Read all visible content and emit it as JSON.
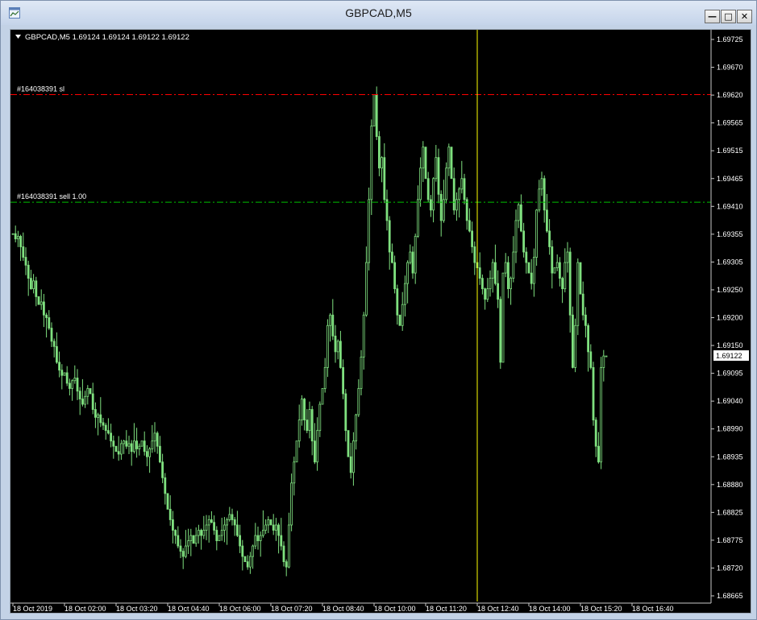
{
  "window": {
    "title": "GBPCAD,M5",
    "icon": "chart-window-icon",
    "buttons": [
      "minimize-icon",
      "restore-icon",
      "close-icon"
    ]
  },
  "chart": {
    "header": "GBPCAD,M5  1.69124 1.69124 1.69122 1.69122",
    "symbol": "GBPCAD",
    "timeframe": "M5",
    "ohlc": {
      "open": "1.69124",
      "high": "1.69124",
      "low": "1.69122",
      "close": "1.69122"
    },
    "colors": {
      "background": "#000000",
      "candle": "#7fe07f",
      "axis_text": "#ffffff",
      "sl_line": "#ff0000",
      "entry_line": "#00c000",
      "crosshair": "#ffff00",
      "price_tag_bg": "#ffffff"
    },
    "order_lines": [
      {
        "label": "#164038391 sl",
        "price": 1.6962,
        "style": "dash-dot",
        "color": "#ff0000"
      },
      {
        "label": "#164038391 sell 1.00",
        "price": 1.69415,
        "style": "dash-dot",
        "color": "#00c000"
      }
    ],
    "vertical_line": {
      "time": "18 Oct 12:35",
      "color": "#ffff00"
    },
    "current_price_label": "1.69122"
  },
  "chart_data": {
    "type": "candlestick",
    "title": "GBPCAD,M5",
    "y_ticks": [
      "1.69725",
      "1.69670",
      "1.69620",
      "1.69565",
      "1.69515",
      "1.69465",
      "1.69410",
      "1.69355",
      "1.69305",
      "1.69250",
      "1.69200",
      "1.69150",
      "1.69095",
      "1.69040",
      "1.68990",
      "1.68935",
      "1.68880",
      "1.68825",
      "1.68775",
      "1.68720",
      "1.68665"
    ],
    "x_ticks": [
      "18 Oct 2019",
      "18 Oct 02:00",
      "18 Oct 03:20",
      "18 Oct 04:40",
      "18 Oct 06:00",
      "18 Oct 07:20",
      "18 Oct 08:40",
      "18 Oct 10:00",
      "18 Oct 11:20",
      "18 Oct 12:40",
      "18 Oct 14:00",
      "18 Oct 15:20",
      "18 Oct 16:40"
    ],
    "ylim": [
      1.68665,
      1.69725
    ],
    "bar_interval_minutes": 5,
    "first_bar_time": "18 Oct 00:35",
    "closes": [
      1.69355,
      1.69345,
      1.6935,
      1.6933,
      1.6931,
      1.69295,
      1.6927,
      1.6925,
      1.69265,
      1.69235,
      1.6922,
      1.69225,
      1.692,
      1.69195,
      1.69175,
      1.6915,
      1.6914,
      1.6911,
      1.69095,
      1.69085,
      1.6909,
      1.6907,
      1.6906,
      1.69075,
      1.6908,
      1.69055,
      1.6904,
      1.6903,
      1.69045,
      1.6906,
      1.6905,
      1.6902,
      1.69005,
      1.6901,
      1.68995,
      1.6899,
      1.6898,
      1.68975,
      1.6896,
      1.6895,
      1.6894,
      1.68935,
      1.68955,
      1.6896,
      1.6895,
      1.68955,
      1.6894,
      1.6896,
      1.68945,
      1.6895,
      1.6896,
      1.6894,
      1.6893,
      1.68945,
      1.6896,
      1.68975,
      1.6895,
      1.6892,
      1.6889,
      1.6886,
      1.6883,
      1.6881,
      1.6879,
      1.6878,
      1.6876,
      1.6875,
      1.6874,
      1.6876,
      1.6877,
      1.6878,
      1.68765,
      1.6878,
      1.6879,
      1.6878,
      1.6879,
      1.688,
      1.6881,
      1.68805,
      1.6879,
      1.6877,
      1.6878,
      1.6879,
      1.688,
      1.6881,
      1.6882,
      1.6881,
      1.688,
      1.6878,
      1.6876,
      1.6874,
      1.6873,
      1.6872,
      1.6874,
      1.6876,
      1.6878,
      1.6877,
      1.6878,
      1.6879,
      1.688,
      1.6881,
      1.688,
      1.6879,
      1.688,
      1.6878,
      1.6876,
      1.6873,
      1.6872,
      1.688,
      1.6888,
      1.6892,
      1.6896,
      1.69,
      1.6904,
      1.69,
      1.6898,
      1.6902,
      1.6896,
      1.6892,
      1.6898,
      1.6903,
      1.6906,
      1.691,
      1.6918,
      1.692,
      1.6916,
      1.6913,
      1.6915,
      1.691,
      1.6905,
      1.6898,
      1.6893,
      1.689,
      1.6896,
      1.6901,
      1.6906,
      1.6912,
      1.692,
      1.693,
      1.6942,
      1.6956,
      1.6962,
      1.6954,
      1.6948,
      1.695,
      1.6942,
      1.6938,
      1.6932,
      1.693,
      1.6925,
      1.692,
      1.6918,
      1.6922,
      1.6926,
      1.693,
      1.6932,
      1.6928,
      1.6935,
      1.6942,
      1.6948,
      1.6952,
      1.6946,
      1.6942,
      1.694,
      1.6946,
      1.695,
      1.6943,
      1.6938,
      1.6942,
      1.6948,
      1.6952,
      1.6946,
      1.694,
      1.6942,
      1.6944,
      1.6946,
      1.6942,
      1.6938,
      1.6936,
      1.6933,
      1.693,
      1.6929,
      1.6927,
      1.6925,
      1.6923,
      1.6925,
      1.6927,
      1.693,
      1.6926,
      1.6923,
      1.6911,
      1.6928,
      1.693,
      1.6925,
      1.6927,
      1.6932,
      1.6938,
      1.6941,
      1.6936,
      1.6932,
      1.693,
      1.6928,
      1.6926,
      1.6931,
      1.694,
      1.6944,
      1.6946,
      1.694,
      1.6936,
      1.6933,
      1.6928,
      1.6929,
      1.693,
      1.6927,
      1.6925,
      1.693,
      1.6932,
      1.692,
      1.691,
      1.6918,
      1.693,
      1.6924,
      1.692,
      1.6918,
      1.6913,
      1.691,
      1.69,
      1.6895,
      1.6892,
      1.691,
      1.69122,
      1.69122
    ]
  }
}
